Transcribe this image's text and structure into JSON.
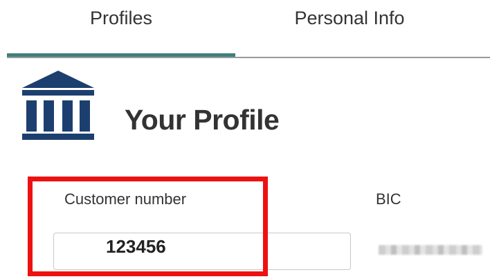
{
  "tabs": [
    {
      "label": "Profiles",
      "active": true
    },
    {
      "label": "Personal Info",
      "active": false
    }
  ],
  "profile": {
    "title": "Your Profile",
    "icon": "bank-building-icon",
    "customer_number_label": "Customer number",
    "customer_number_value": "123456",
    "bic_label": "BIC",
    "bic_value_state": "blurred"
  },
  "colors": {
    "active_tab_underline": "#3f7f7a",
    "icon": "#1c3f6f",
    "highlight_border": "#ee1111",
    "text": "#333333"
  }
}
